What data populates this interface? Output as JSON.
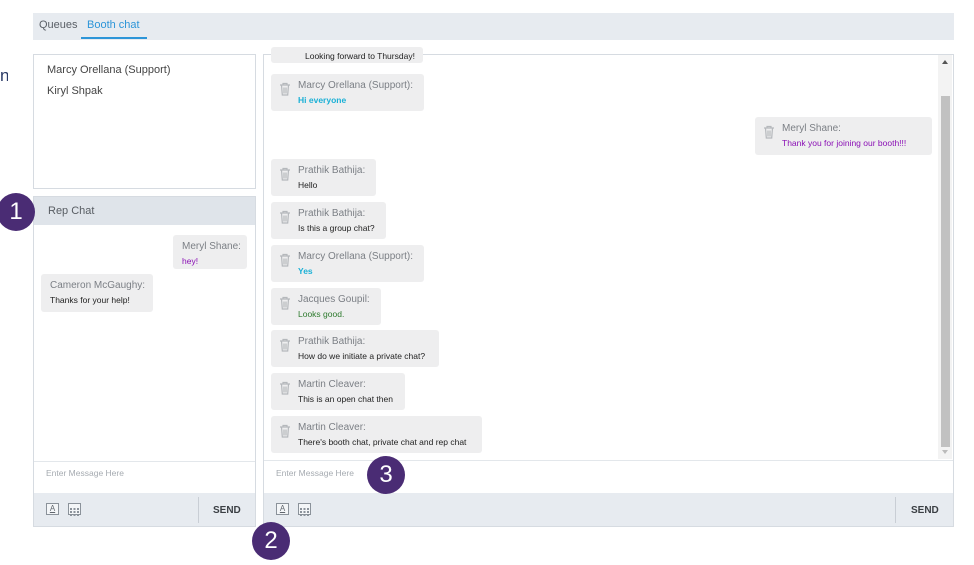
{
  "tabs": [
    {
      "label": "Queues",
      "active": false
    },
    {
      "label": "Booth chat",
      "active": true
    }
  ],
  "edge_char": "n",
  "users": [
    "Marcy Orellana (Support)",
    "Kiryl Shpak"
  ],
  "rep_chat": {
    "title": "Rep Chat",
    "messages": [
      {
        "sender": "Meryl Shane:",
        "body": "hey!",
        "body_color": "#8a0fb5"
      },
      {
        "sender": "Cameron McGaughy:",
        "body": "Thanks for your help!",
        "body_color": "#222222"
      }
    ],
    "placeholder": "Enter Message Here",
    "send_label": "SEND"
  },
  "booth_chat": {
    "partial_top_text": "Looking forward to Thursday!",
    "messages": [
      {
        "sender": "Marcy Orellana (Support):",
        "body": "Hi everyone",
        "body_color": "#1ab0d6",
        "bold": true
      },
      {
        "sender": "Meryl Shane:",
        "body": "Thank you for joining our booth!!!",
        "body_color": "#8a0fb5",
        "bold": false
      },
      {
        "sender": "Prathik Bathija:",
        "body": "Hello",
        "body_color": "#222222",
        "bold": false
      },
      {
        "sender": "Prathik Bathija:",
        "body": "Is this a group chat?",
        "body_color": "#222222",
        "bold": false
      },
      {
        "sender": "Marcy Orellana (Support):",
        "body": "Yes",
        "body_color": "#1ab0d6",
        "bold": true
      },
      {
        "sender": "Jacques Goupil:",
        "body": "Looks good.",
        "body_color": "#2d7a2d",
        "bold": false
      },
      {
        "sender": "Prathik Bathija:",
        "body": "How do we initiate a private chat?",
        "body_color": "#222222",
        "bold": false
      },
      {
        "sender": "Martin Cleaver:",
        "body": "This is an open chat then",
        "body_color": "#222222",
        "bold": false
      },
      {
        "sender": "Martin Cleaver:",
        "body": "There's booth chat, private chat and rep chat",
        "body_color": "#222222",
        "bold": false
      }
    ],
    "placeholder": "Enter Message Here",
    "send_label": "SEND"
  },
  "toolbar_font_glyph": "A",
  "callouts": [
    "1",
    "2",
    "3"
  ]
}
